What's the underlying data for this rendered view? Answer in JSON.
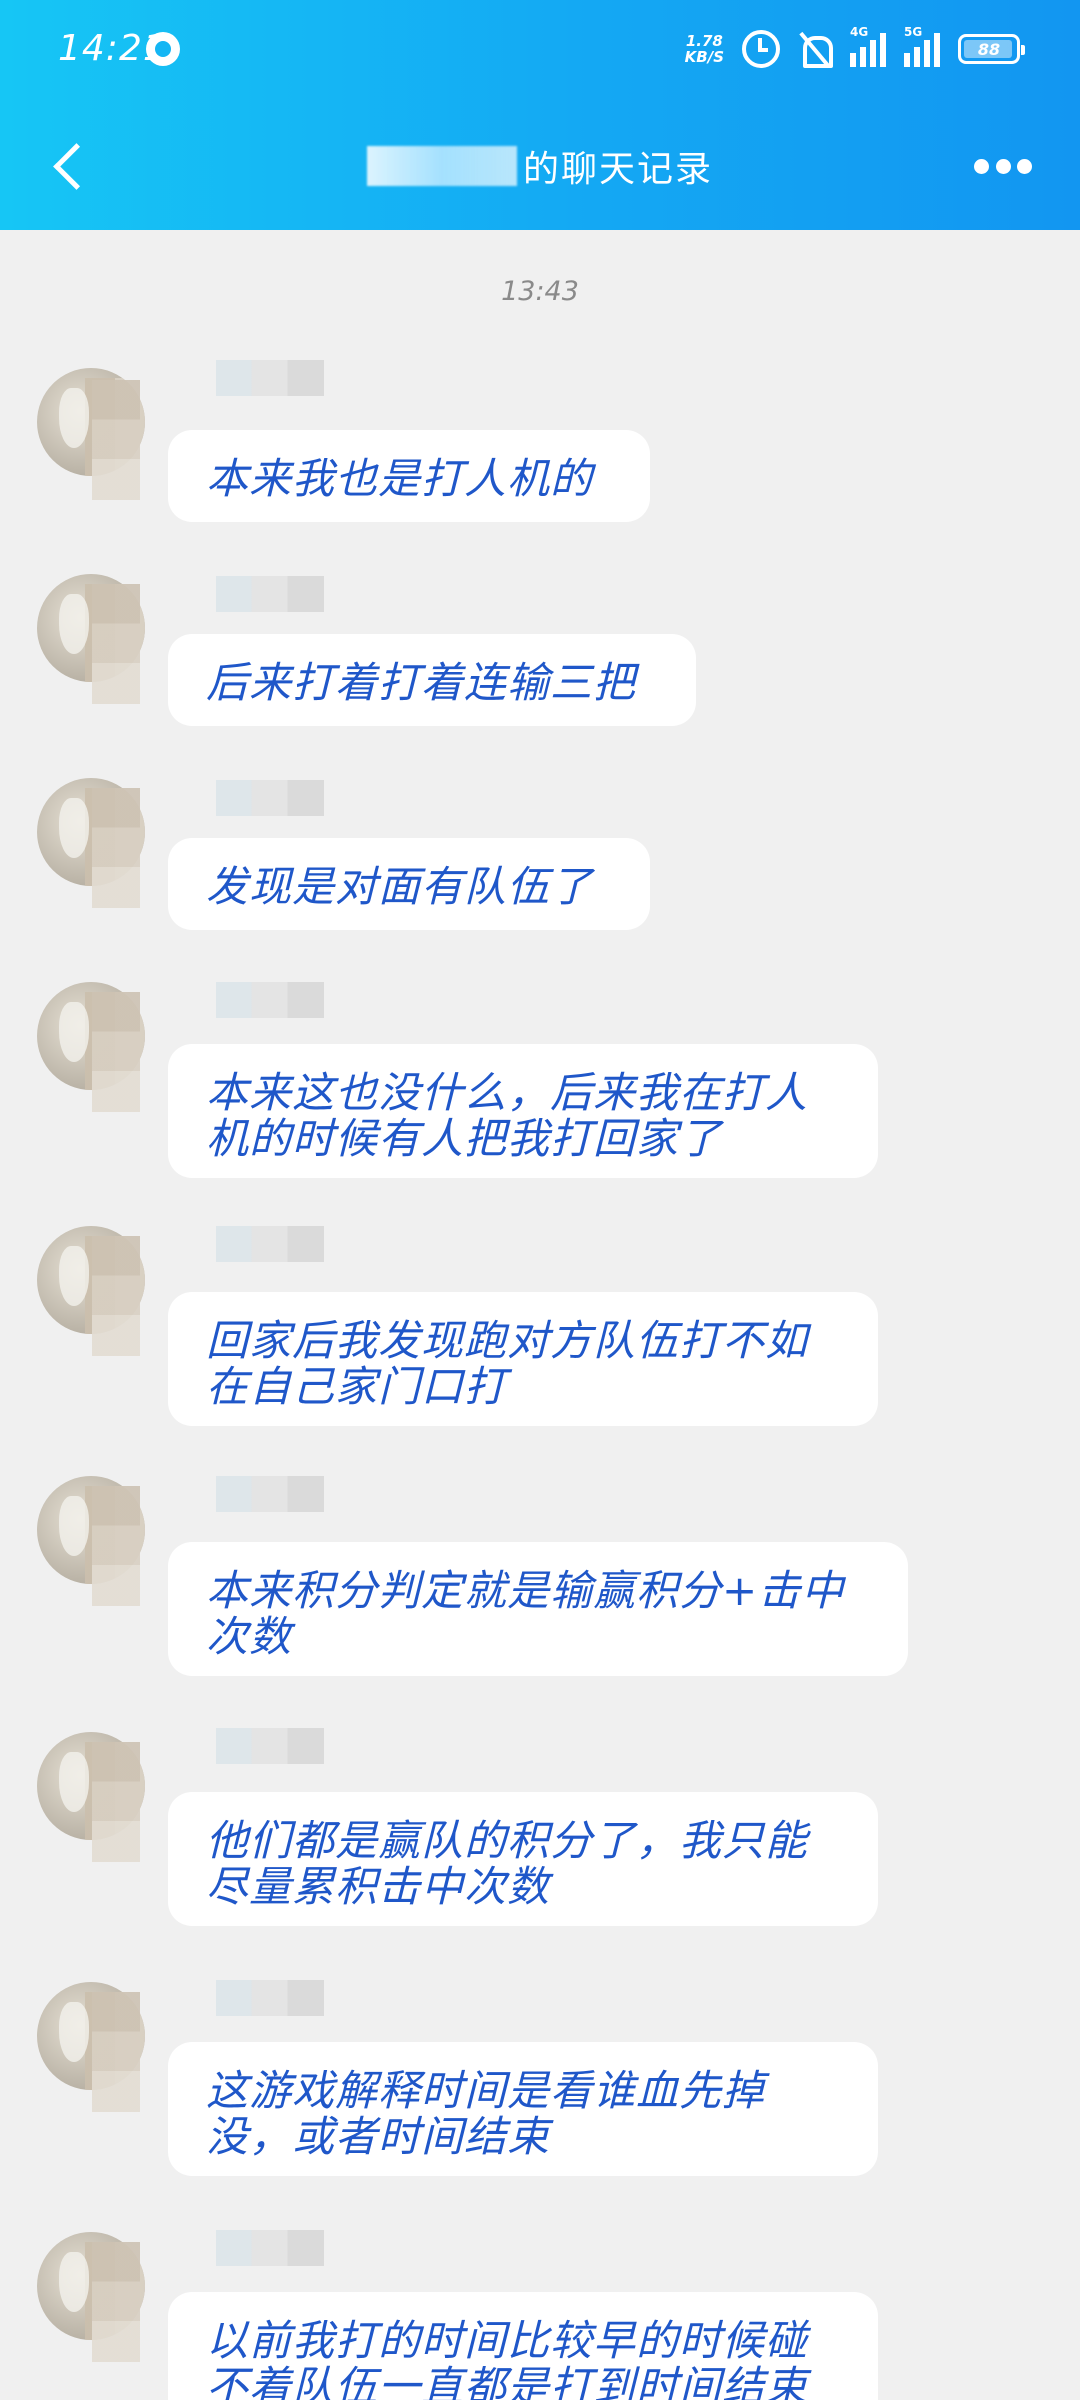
{
  "status_bar": {
    "time": "14:21",
    "net_speed_value": "1.78",
    "net_speed_unit": "KB/S",
    "signal_1_gen": "4G",
    "signal_2_gen": "5G",
    "battery": "88"
  },
  "nav": {
    "title": "的聊天记录"
  },
  "chat": {
    "timestamp": "13:43",
    "messages": [
      "本来我也是打人机的",
      "后来打着打着连输三把",
      "发现是对面有队伍了",
      "本来这也没什么，后来我在打人机的时候有人把我打回家了",
      "回家后我发现跑对方队伍打不如在自己家门口打",
      "本来积分判定就是输赢积分+击中次数",
      "他们都是赢队的积分了，我只能尽量累积击中次数",
      "这游戏解释时间是看谁血先掉没，或者时间结束",
      "以前我打的时间比较早的时候碰不着队伍一直都是打到时间结束"
    ]
  },
  "colors": {
    "header_gradient_start": "#16c6f5",
    "header_gradient_end": "#1296f1",
    "background": "#f0f0f0",
    "bubble": "#ffffff",
    "message_text": "#1f57c9",
    "timestamp_text": "#8a8a8a"
  },
  "icons": [
    "back-icon",
    "more-icon",
    "alarm-icon",
    "mute-icon",
    "signal-icon",
    "battery-icon"
  ]
}
